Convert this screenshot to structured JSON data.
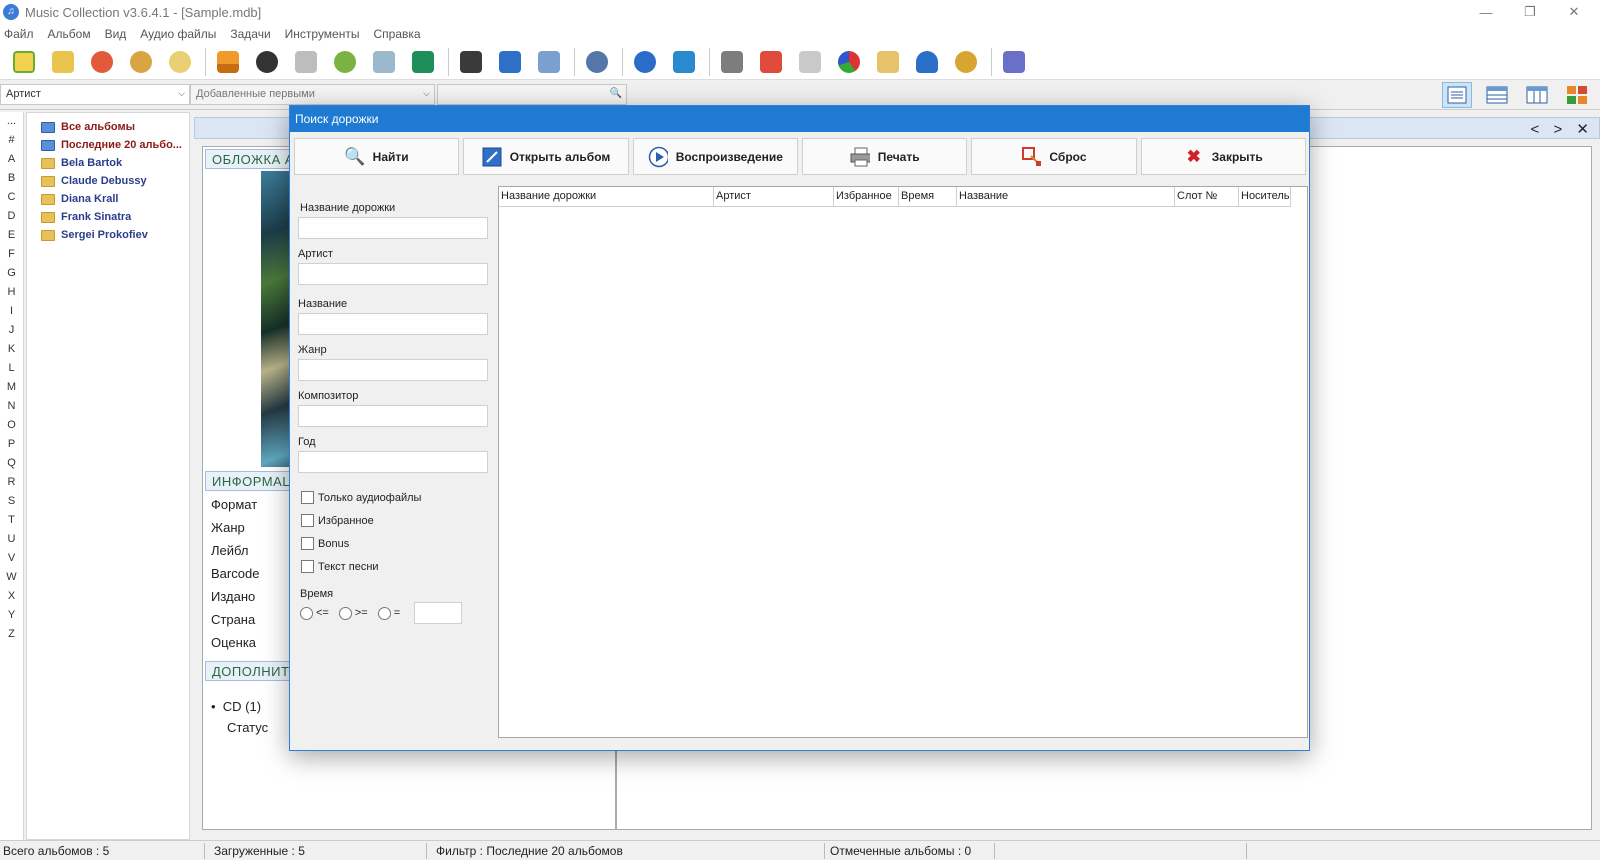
{
  "window": {
    "title": "Music Collection v3.6.4.1 - [Sample.mdb]",
    "app_icon_glyph": "♫",
    "minimize_glyph": "—",
    "restore_glyph": "❐",
    "close_glyph": "✕"
  },
  "menu": {
    "items": [
      "Файл",
      "Альбом",
      "Вид",
      "Аудио файлы",
      "Задачи",
      "Инструменты",
      "Справка"
    ]
  },
  "filterbar": {
    "combo1": "Артист",
    "combo2": "Добавленные первыми",
    "arrow_glyph": "⌵",
    "search_glyph": "🔍"
  },
  "letters": [
    "...",
    "#",
    "A",
    "B",
    "C",
    "D",
    "E",
    "F",
    "G",
    "H",
    "I",
    "J",
    "K",
    "L",
    "M",
    "N",
    "O",
    "P",
    "Q",
    "R",
    "S",
    "T",
    "U",
    "V",
    "W",
    "X",
    "Y",
    "Z"
  ],
  "tree": {
    "items": [
      {
        "label": "Все альбомы"
      },
      {
        "label": "Последние 20 альбо..."
      },
      {
        "label": "Bela Bartok"
      },
      {
        "label": "Claude Debussy"
      },
      {
        "label": "Diana Krall"
      },
      {
        "label": "Frank Sinatra"
      },
      {
        "label": "Sergei Prokofiev"
      }
    ]
  },
  "main": {
    "nav_prev": "<",
    "nav_next": ">",
    "nav_close": "✕",
    "section_cover": "ОБЛОЖКА А",
    "section_info": "ИНФОРМАЦ",
    "section_extra": "ДОПОЛНИТ",
    "info_rows": [
      "Формат",
      "Жанр",
      "Лейбл",
      "Barcode",
      "Издано",
      "Страна",
      "Оценка"
    ],
    "cd_label": "CD (1)",
    "status_label": "Статус",
    "bullet": "•"
  },
  "dialog": {
    "title": "Поиск дорожки",
    "buttons": {
      "find": "Найти",
      "open_album": "Открыть альбом",
      "play": "Воспроизведение",
      "print": "Печать",
      "reset": "Сброс",
      "close": "Закрыть"
    },
    "icons": {
      "find": "🔍",
      "play": "▶",
      "close": "✖"
    },
    "form": {
      "track_name_label": "Название дорожки",
      "artist_label": "Артист",
      "title_label": "Название",
      "genre_label": "Жанр",
      "composer_label": "Композитор",
      "year_label": "Год",
      "track_name_value": "",
      "artist_value": "",
      "title_value": "",
      "genre_value": "",
      "composer_value": "",
      "year_value": "",
      "only_audio": "Только аудиофайлы",
      "favorites": "Избранное",
      "bonus": "Bonus",
      "lyrics": "Текст песни",
      "time_label": "Время",
      "time_le": "<=",
      "time_ge": ">=",
      "time_eq": "=",
      "time_value": ""
    },
    "grid_columns": [
      "Название дорожки",
      "Артист",
      "Избранное",
      "Время",
      "Название",
      "Слот №",
      "Носитель"
    ]
  },
  "statusbar": {
    "total_albums": "Всего альбомов : 5",
    "loaded": "Загруженные : 5",
    "filter": "Фильтр : Последние 20 альбомов",
    "marked": "Отмеченные альбомы : 0"
  },
  "colors": {
    "dialog_title_bg": "#1e7ad2",
    "section_text": "#2a6a3a",
    "tree_text": "#2a3d8c",
    "tree_text_active": "#8b1a1a"
  }
}
